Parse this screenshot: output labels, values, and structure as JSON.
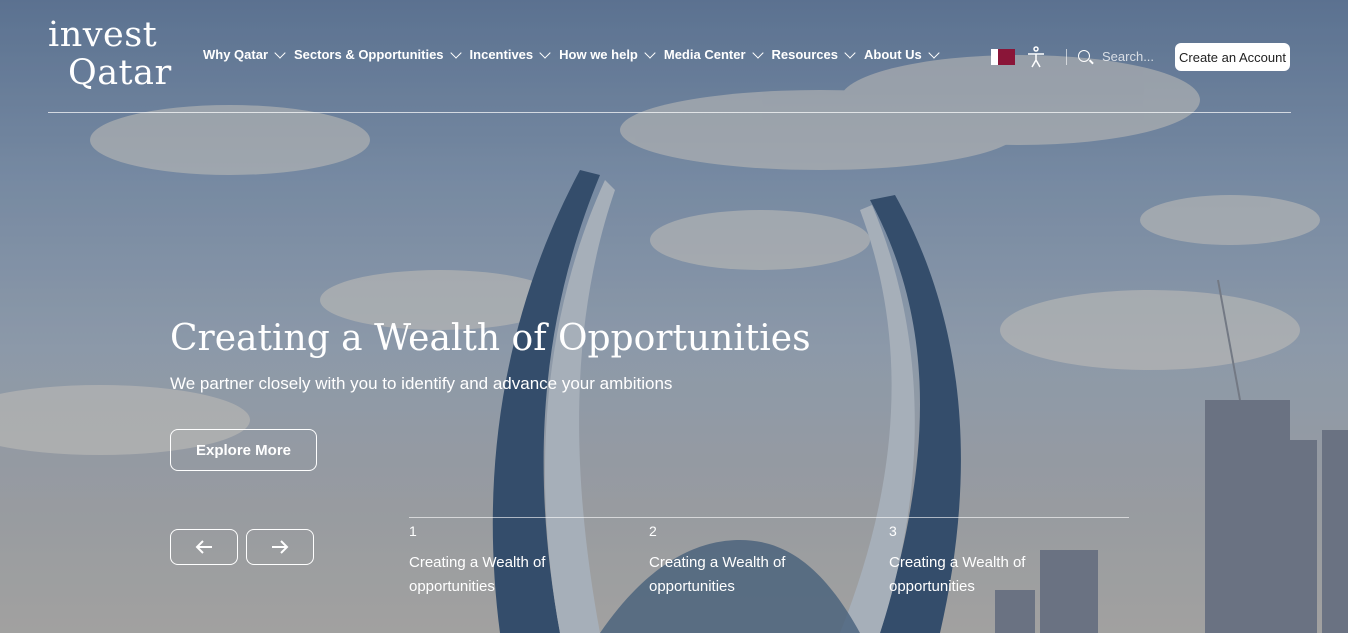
{
  "brand": {
    "line1": "invest",
    "line2": "Qatar"
  },
  "nav": {
    "items": [
      {
        "label": "Why Qatar"
      },
      {
        "label": "Sectors & Opportunities"
      },
      {
        "label": "Incentives"
      },
      {
        "label": "How we help"
      },
      {
        "label": "Media Center"
      },
      {
        "label": "Resources"
      },
      {
        "label": "About Us"
      }
    ]
  },
  "header": {
    "search_placeholder": "Search...",
    "create_account": "Create an Account",
    "language_icon": "qatar-flag-icon",
    "accessibility_icon": "accessibility-icon"
  },
  "hero": {
    "title": "Creating a Wealth of Opportunities",
    "subtitle": "We partner closely with you to identify and advance your ambitions",
    "cta": "Explore More"
  },
  "slider": {
    "slides": [
      {
        "num": "1",
        "caption": "Creating a Wealth of opportunities"
      },
      {
        "num": "2",
        "caption": "Creating a Wealth of opportunities"
      },
      {
        "num": "3",
        "caption": "Creating a Wealth of opportunities"
      }
    ]
  },
  "colors": {
    "flag_maroon": "#8a1538",
    "accent_white": "#ffffff"
  }
}
